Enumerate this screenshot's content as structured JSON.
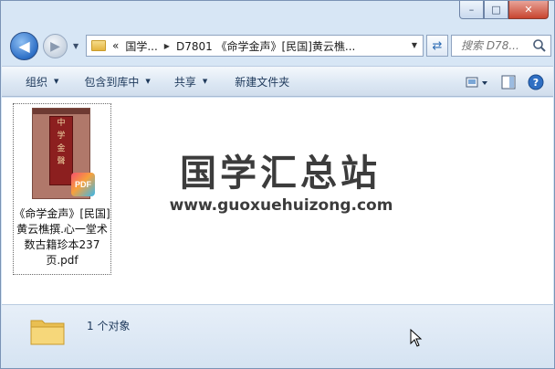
{
  "window": {
    "caption": {
      "minimize": "–",
      "maximize": "□",
      "close": "✕"
    }
  },
  "address": {
    "crumbs": [
      "«",
      "国学...",
      "D7801 《命学金声》[民国]黄云樵..."
    ],
    "search_placeholder": "搜索 D78..."
  },
  "toolbar": {
    "organize": "组织",
    "include_library": "包含到库中",
    "share": "共享",
    "new_folder": "新建文件夹"
  },
  "file": {
    "name": "《命学金声》[民国]黄云樵撰.心一堂术数古籍珍本237页.pdf",
    "badge": "PDF",
    "cover_chars": [
      "中",
      "学",
      "金",
      "聲"
    ]
  },
  "watermark": {
    "title": "国学汇总站",
    "url": "www.guoxuehuizong.com"
  },
  "status": {
    "count": "1 个对象"
  },
  "colors": {
    "accent": "#1e395b",
    "chrome": "#d7e6f5"
  }
}
